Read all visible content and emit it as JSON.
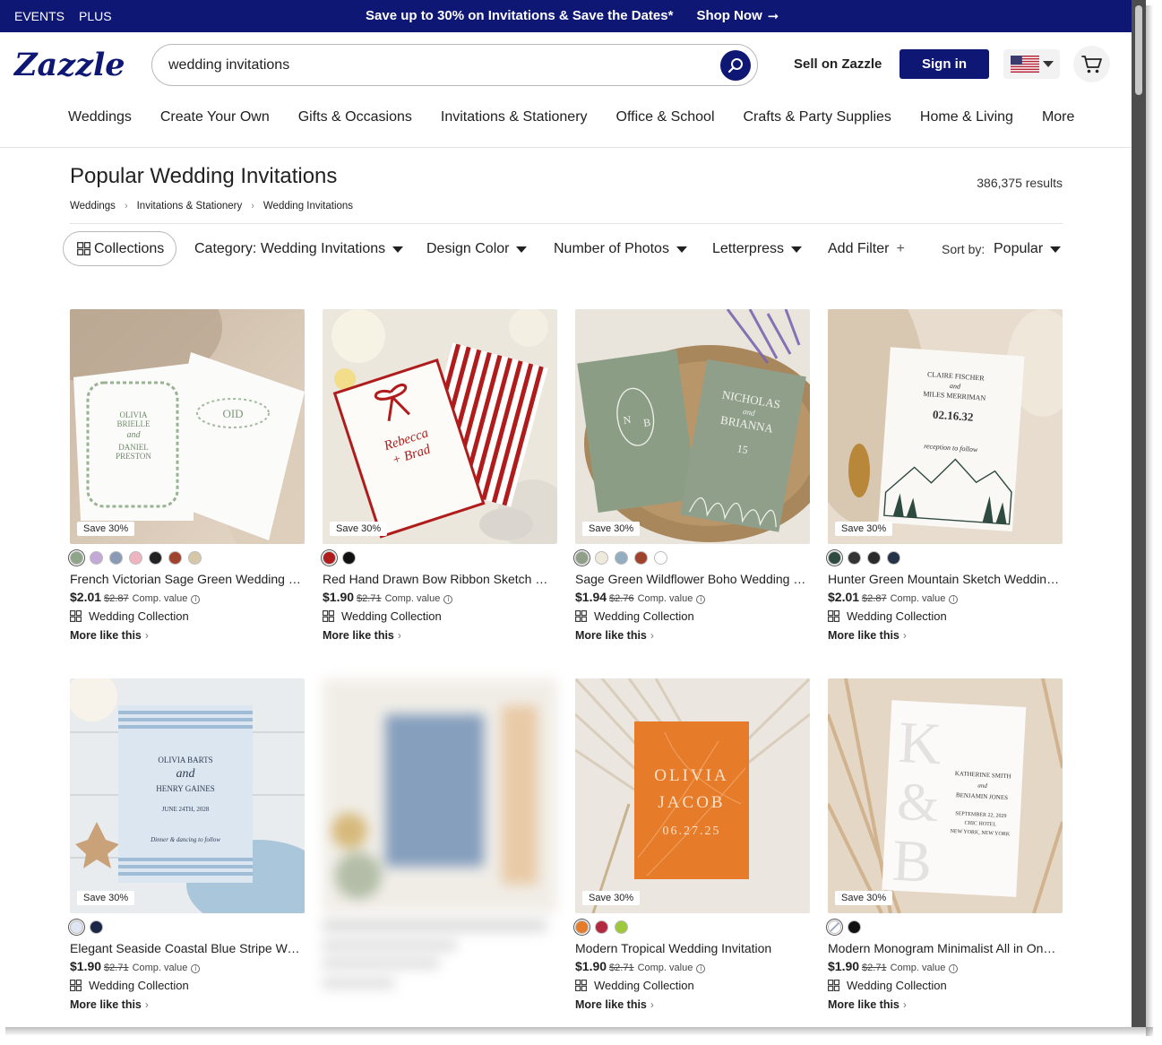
{
  "promo": {
    "left_links": [
      "EVENTS",
      "PLUS"
    ],
    "message": "Save up to 30% on Invitations & Save the Dates*",
    "cta": "Shop Now",
    "cta_arrow": "➞"
  },
  "header": {
    "logo": "Zazzle",
    "search_value": "wedding invitations",
    "sell_label": "Sell on Zazzle",
    "signin_label": "Sign in",
    "country_icon": "us-flag-icon",
    "cart_icon": "cart-icon"
  },
  "nav": [
    "Weddings",
    "Create Your Own",
    "Gifts & Occasions",
    "Invitations & Stationery",
    "Office & School",
    "Crafts & Party Supplies",
    "Home & Living",
    "More"
  ],
  "page": {
    "title": "Popular Wedding Invitations",
    "results": "386,375 results",
    "breadcrumbs": [
      "Weddings",
      "Invitations & Stationery",
      "Wedding Invitations"
    ]
  },
  "filters": {
    "collections": "Collections",
    "category": "Category: Wedding Invitations",
    "design_color": "Design Color",
    "photos": "Number of Photos",
    "letterpress": "Letterpress",
    "add_filter": "Add Filter",
    "add_symbol": "+",
    "sort_label": "Sort by:",
    "sort_value": "Popular"
  },
  "colors": {
    "brand": "#0f1775"
  },
  "products": [
    {
      "badge": "Save 30%",
      "swatches": [
        "#8fa589",
        "#c3a9d8",
        "#8b9ab4",
        "#eeb5c1",
        "#222222",
        "#a0432d",
        "#d7c7a9"
      ],
      "name": "French Victorian Sage Green Wedding M...",
      "price": "$2.01",
      "orig": "$2.87",
      "comp": "Comp. value",
      "collection": "Wedding Collection",
      "more": "More like this",
      "thumb_text": [
        "OLIVIA",
        "BRIELLE",
        "and",
        "DANIEL",
        "PRESTON",
        "OID"
      ]
    },
    {
      "badge": "Save 30%",
      "swatches": [
        "#b01c1c",
        "#111111"
      ],
      "name": "Red Hand Drawn Bow Ribbon Sketch We...",
      "price": "$1.90",
      "orig": "$2.71",
      "comp": "Comp. value",
      "collection": "Wedding Collection",
      "more": "More like this",
      "thumb_text": [
        "Rebecca",
        "+ Brad"
      ]
    },
    {
      "badge": "Save 30%",
      "swatches": [
        "#8f9f88",
        "#eeeadc",
        "#93aec0",
        "#a0432d",
        "#ffffff"
      ],
      "name": "Sage Green Wildflower Boho Wedding M...",
      "price": "$1.94",
      "orig": "$2.76",
      "comp": "Comp. value",
      "collection": "Wedding Collection",
      "more": "More like this",
      "thumb_text": [
        "N",
        "B",
        "NICHOLAS",
        "and",
        "BRIANNA",
        "15"
      ]
    },
    {
      "badge": "Save 30%",
      "swatches": [
        "#2f4a40",
        "#333333",
        "#2a2a2a",
        "#263248"
      ],
      "name": "Hunter Green Mountain Sketch Wedding ...",
      "price": "$2.01",
      "orig": "$2.87",
      "comp": "Comp. value",
      "collection": "Wedding Collection",
      "more": "More like this",
      "thumb_text": [
        "CLAIRE FISCHER",
        "and",
        "MILES MERRIMAN",
        "02.16.32",
        "reception to follow"
      ]
    },
    {
      "badge": "Save 30%",
      "swatches": [
        "#dfe6f2",
        "#1b2748"
      ],
      "name": "Elegant Seaside Coastal Blue Stripe Wed...",
      "price": "$1.90",
      "orig": "$2.71",
      "comp": "Comp. value",
      "collection": "Wedding Collection",
      "more": "More like this",
      "thumb_text": [
        "OLIVIA BARTS",
        "and",
        "HENRY GAINES",
        "JUNE 24TH, 2028",
        "Dinner & dancing to follow"
      ]
    },
    {
      "badge": "",
      "swatches": [],
      "name": "",
      "price": "",
      "orig": "",
      "comp": "",
      "collection": "",
      "more": "",
      "thumb_text": [],
      "blurred": true
    },
    {
      "badge": "Save 30%",
      "swatches": [
        "#e67c2a",
        "#b32a40",
        "#9ec93a"
      ],
      "name": "Modern Tropical Wedding Invitation",
      "price": "$1.90",
      "orig": "$2.71",
      "comp": "Comp. value",
      "collection": "Wedding Collection",
      "more": "More like this",
      "thumb_text": [
        "OLIVIA",
        "JACOB",
        "06.27.25"
      ]
    },
    {
      "badge": "Save 30%",
      "swatches": [
        "#ffffff",
        "#111111"
      ],
      "name": "Modern Monogram Minimalist All in One ...",
      "price": "$1.90",
      "orig": "$2.71",
      "comp": "Comp. value",
      "collection": "Wedding Collection",
      "more": "More like this",
      "thumb_text": [
        "K",
        "&",
        "B",
        "KATHERINE SMITH",
        "and",
        "BENJAMIN JONES",
        "SEPTEMBER 22, 2029",
        "CHIC HOTEL",
        "NEW YORK, NEW YORK"
      ]
    }
  ]
}
